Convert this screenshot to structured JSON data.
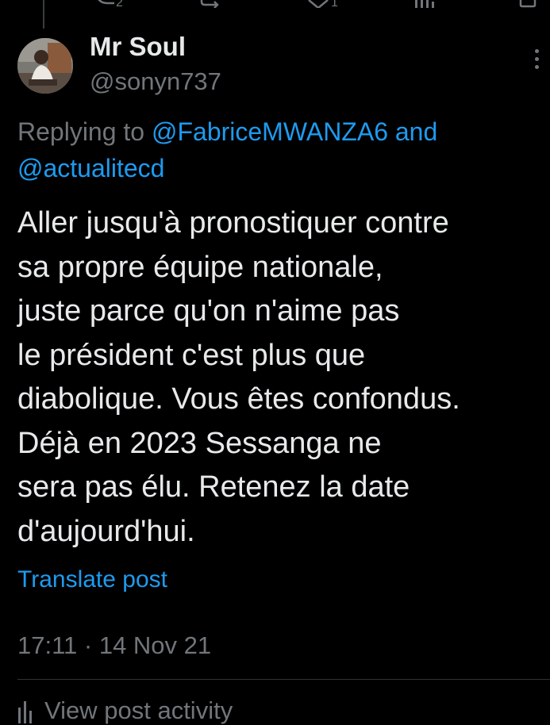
{
  "tweet": {
    "author": {
      "display_name": "Mr Soul",
      "handle": "@sonyn737",
      "avatar": "profile-photo"
    },
    "replying_to": {
      "prefix": "Replying to",
      "mention_1": "@FabriceMWANZA6",
      "conjunction": "and",
      "mention_2": "@actualitecd"
    },
    "text_lines": [
      "Aller jusqu'à pronostiquer contre",
      "sa propre équipe nationale,",
      "juste parce qu'on n'aime pas",
      "le président c'est plus que",
      "diabolique. Vous êtes confondus.",
      "Déjà en 2023 Sessanga ne",
      "sera pas élu. Retenez la date",
      "d'aujourd'hui."
    ],
    "translate_label": "Translate post",
    "timestamp": "17:11 · 14 Nov 21",
    "activity_label": "View post activity"
  },
  "icons": {
    "more": "more-vertical-icon",
    "activity": "bar-chart-icon",
    "top_row": [
      "reply-icon",
      "retweet-icon",
      "like-icon",
      "views-icon",
      "share-icon"
    ]
  },
  "colors": {
    "background": "#000000",
    "text_primary": "#e7e9ea",
    "text_secondary": "#71767b",
    "link": "#1d9bf0",
    "divider": "#2f3336"
  }
}
